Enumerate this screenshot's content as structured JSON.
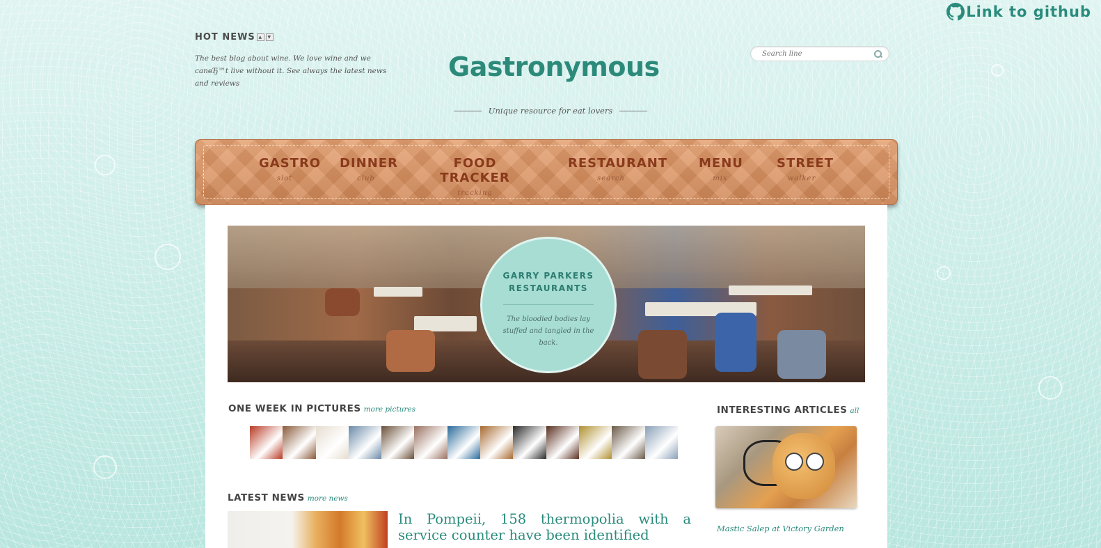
{
  "github": {
    "label": "Link to github"
  },
  "hot_news": {
    "title": "HOT NEWS",
    "text": "The best blog about wine. We love wine and we canвЂ™t live without it. See always the latest news and reviews"
  },
  "site": {
    "logo": "Gastronymous",
    "tagline": "Unique resource for eat lovers"
  },
  "search": {
    "placeholder": "Search line"
  },
  "nav": [
    {
      "label": "GASTRO",
      "sub": "slot"
    },
    {
      "label": "DINNER",
      "sub": "club"
    },
    {
      "label": "FOOD TRACKER",
      "sub": "tracking"
    },
    {
      "label": "RESTAURANT",
      "sub": "search"
    },
    {
      "label": "MENU",
      "sub": "mix"
    },
    {
      "label": "STREET",
      "sub": "walker"
    }
  ],
  "hero": {
    "title_line1": "GARRY PARKERS",
    "title_line2": "RESTAURANTS",
    "description": "The bloodied bodies lay stuffed and tangled in the back."
  },
  "week_pictures": {
    "title": "ONE WEEK IN PICTURES",
    "more": "more pictures",
    "thumb_colors": [
      "#b83a24",
      "#8a5a3a",
      "#e6ddd0",
      "#6a8aa8",
      "#6b5038",
      "#9a7060",
      "#2a6a9a",
      "#a86a30",
      "#2a2a2a",
      "#5a3020",
      "#b09030",
      "#6a5a48",
      "#8aa0b8"
    ]
  },
  "latest_news": {
    "title": "LATEST NEWS",
    "more": "more news",
    "headline": "In Pompeii, 158 thermopolia with a service counter have been identified"
  },
  "articles": {
    "title": "INTERESTING ARTICLES",
    "more": "all",
    "caption": "Mastic Salep at Victory Garden"
  },
  "colors": {
    "accent": "#2a8b7c",
    "nav_text": "#8a3a1c",
    "background": "#bfe8e2"
  }
}
